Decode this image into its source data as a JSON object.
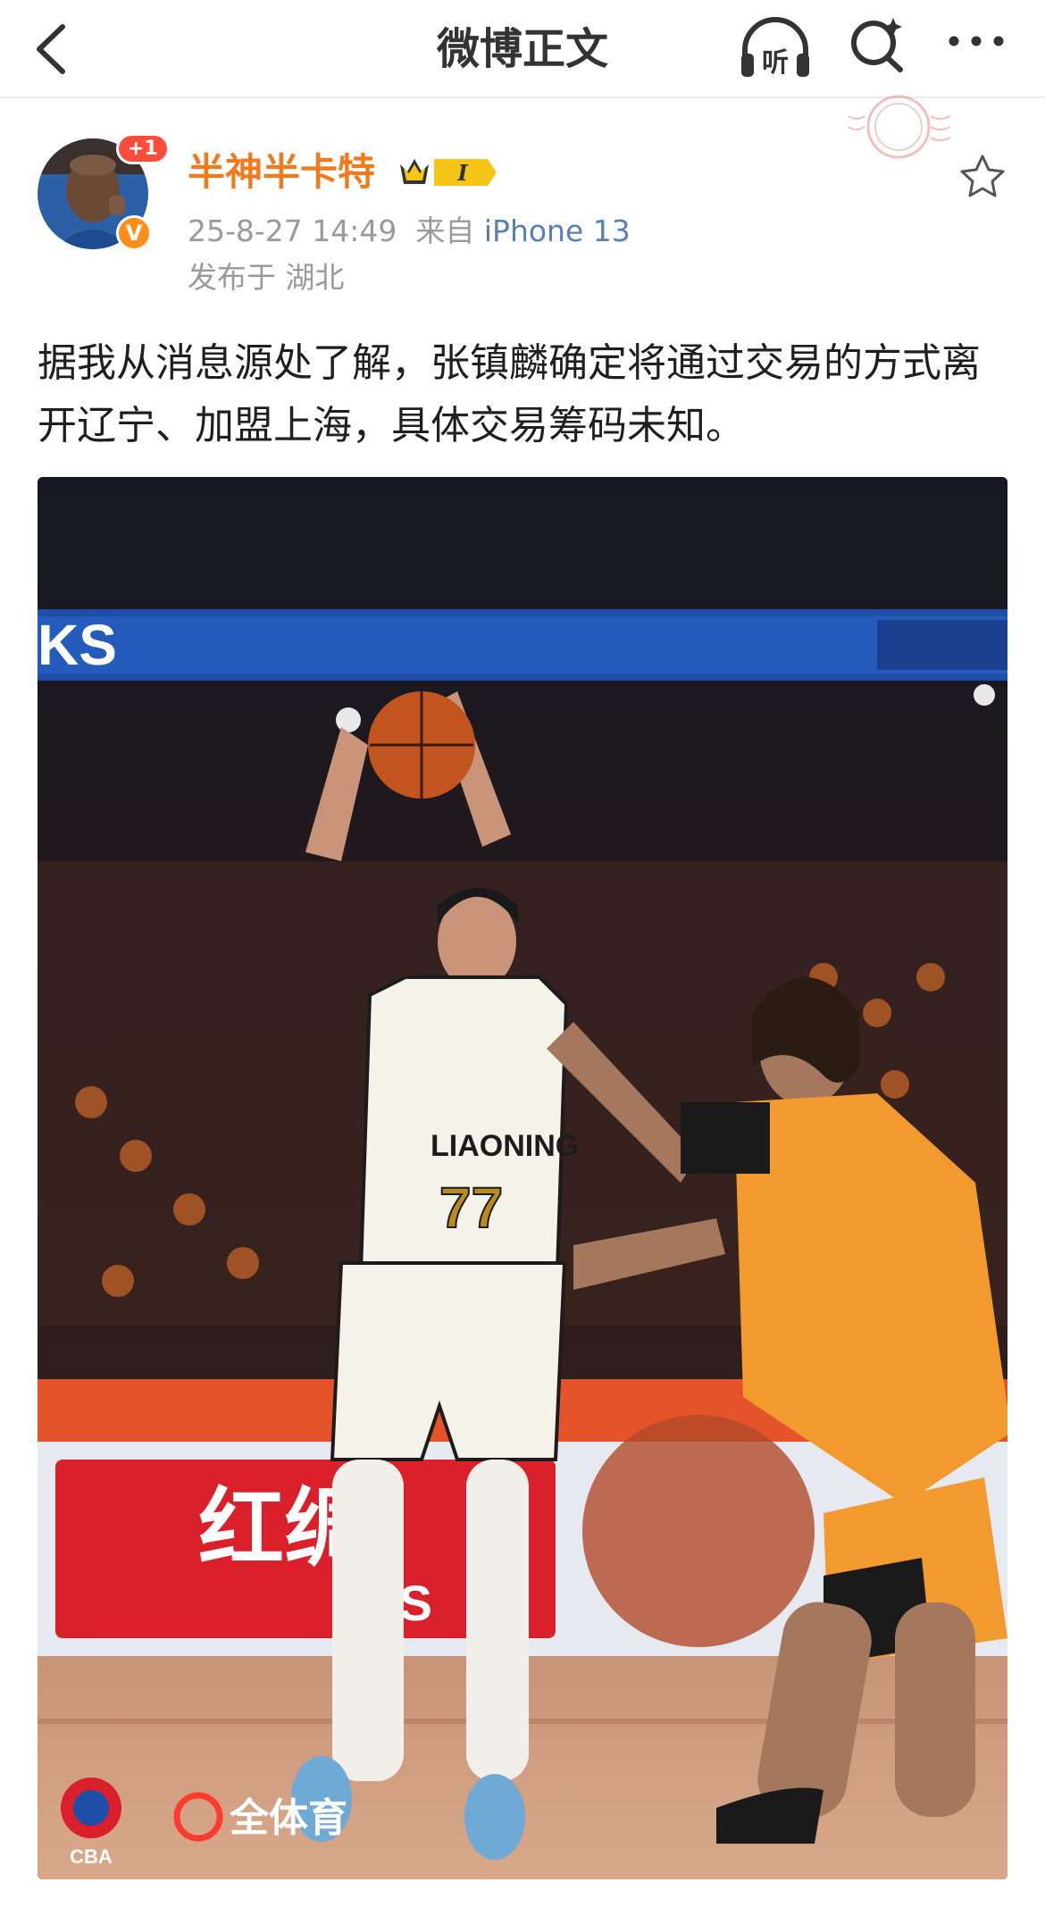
{
  "header": {
    "title": "微博正文",
    "back_icon": "chevron-left-icon",
    "listen_label": "听",
    "search_icon": "search-icon",
    "more_icon": "more-dots-icon"
  },
  "author": {
    "name": "半神半卡特",
    "notification_badge": "+1",
    "verified_badge": "V",
    "vip_level": "I"
  },
  "post": {
    "date": "25-8-27 14:49",
    "source_prefix": "来自",
    "device": "iPhone 13",
    "location": "发布于 湖北",
    "text": "据我从消息源处了解，张镇麟确定将通过交易的方式离开辽宁、加盟上海，具体交易筹码未知。"
  },
  "photo": {
    "jersey_number": "77",
    "jersey_text": "LIAONING",
    "board_text": "红绸",
    "board_text_2": "ZHS",
    "watermark": "全体育",
    "cba_logo_text": "CBA",
    "banner_text": "KS"
  },
  "colors": {
    "username": "#f07a1e",
    "device_link": "#5a7fb5",
    "orange_jersey": "#f29a2e"
  }
}
